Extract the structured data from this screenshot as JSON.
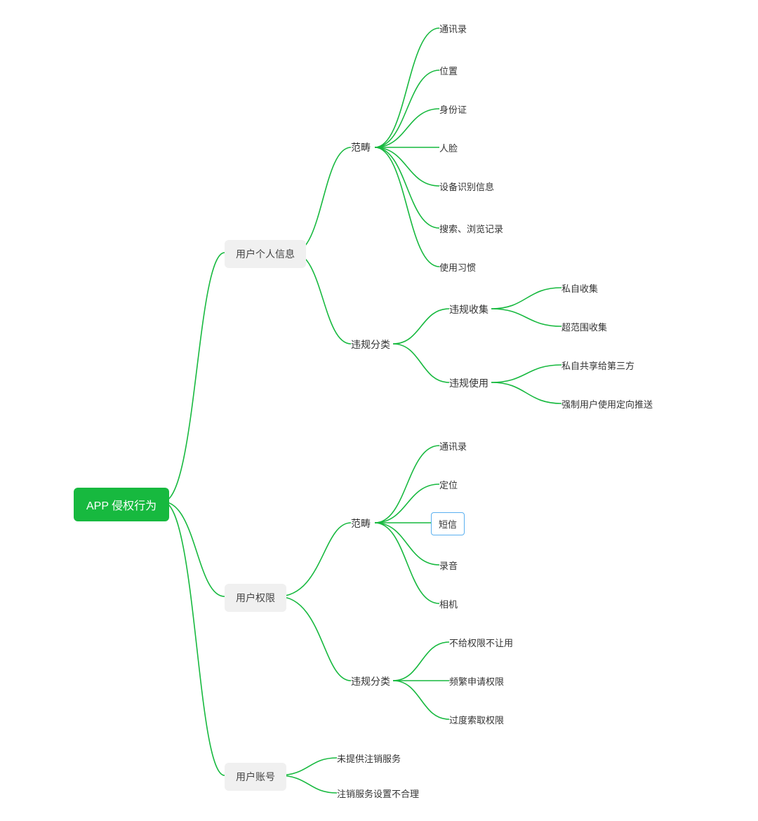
{
  "root": "APP 侵权行为",
  "branches": {
    "personalInfo": {
      "label": "用户个人信息",
      "scope": {
        "label": "范畴",
        "items": [
          "通讯录",
          "位置",
          "身份证",
          "人脸",
          "设备识别信息",
          "搜索、浏览记录",
          "使用习惯"
        ]
      },
      "violations": {
        "label": "违规分类",
        "collection": {
          "label": "违规收集",
          "items": [
            "私自收集",
            "超范围收集"
          ]
        },
        "usage": {
          "label": "违规使用",
          "items": [
            "私自共享给第三方",
            "强制用户使用定向推送"
          ]
        }
      }
    },
    "permissions": {
      "label": "用户权限",
      "scope": {
        "label": "范畴",
        "items": [
          "通讯录",
          "定位",
          "短信",
          "录音",
          "相机"
        ],
        "selectedIndex": 2
      },
      "violations": {
        "label": "违规分类",
        "items": [
          "不给权限不让用",
          "频繁申请权限",
          "过度索取权限"
        ]
      }
    },
    "account": {
      "label": "用户账号",
      "items": [
        "未提供注销服务",
        "注销服务设置不合理"
      ]
    }
  },
  "colors": {
    "stroke": "#17b93f",
    "root": "#17b93f",
    "branchBg": "#f0f0f0",
    "selectedBorder": "#5ab0f0"
  }
}
